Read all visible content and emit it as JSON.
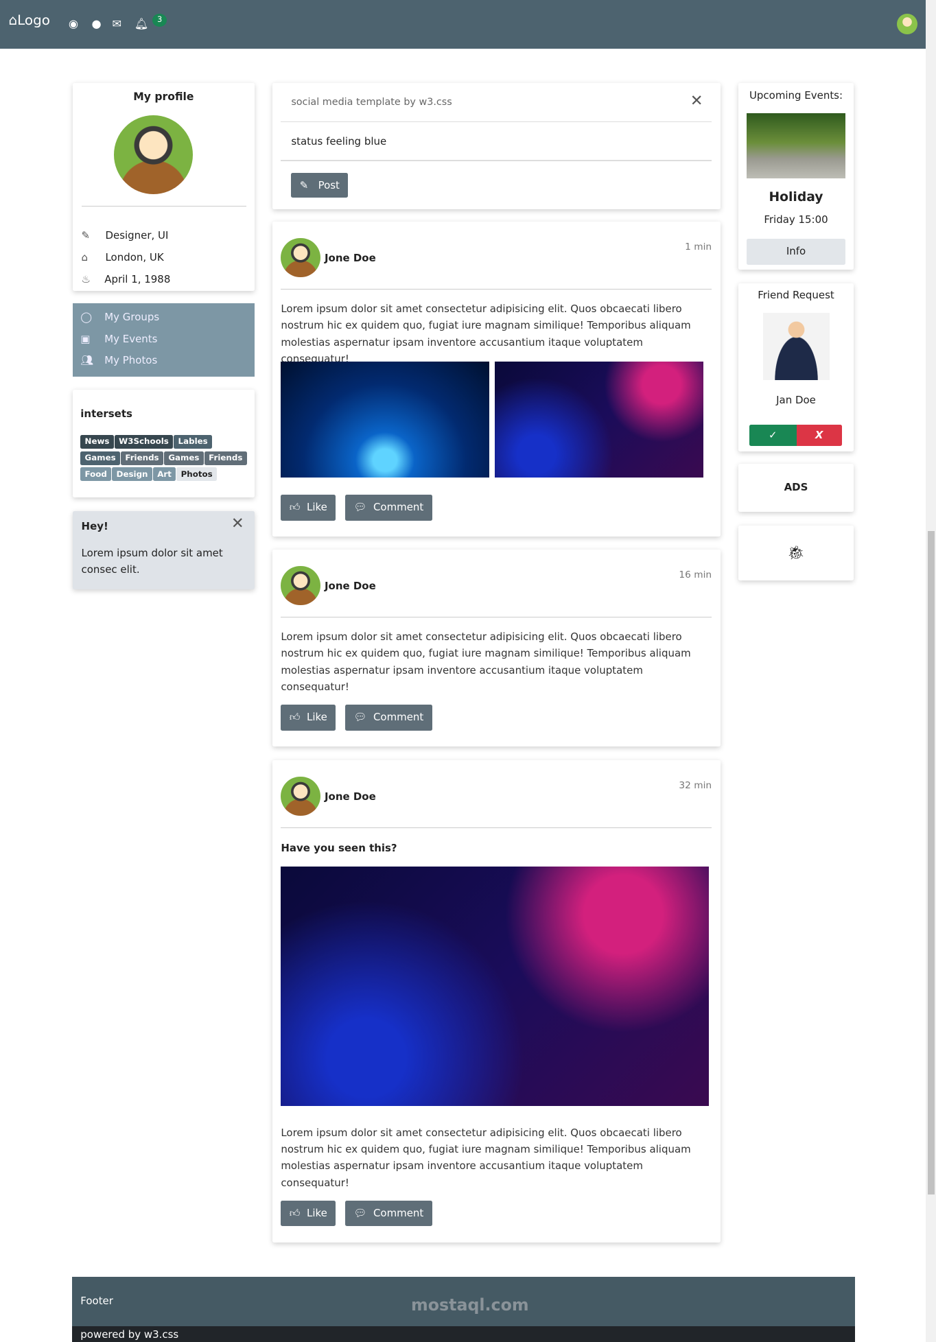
{
  "nav": {
    "logo": "Logo",
    "icons": [
      "home-icon",
      "globe-icon",
      "user-icon",
      "envelope-icon",
      "bell-icon"
    ],
    "notifications": "3",
    "color": "#4d636f"
  },
  "profile": {
    "title": "My profile",
    "job": "Designer, UI",
    "location": "London, UK",
    "birthday": "April 1, 1988"
  },
  "menu": {
    "items": [
      "My Groups",
      "My Events",
      "My Photos"
    ]
  },
  "interests": {
    "title": "intersets",
    "tags": [
      {
        "label": "News",
        "color": "#37474f"
      },
      {
        "label": "W3Schools",
        "color": "#37474f"
      },
      {
        "label": "Lables",
        "color": "#4d636f"
      },
      {
        "label": "Games",
        "color": "#4d636f"
      },
      {
        "label": "Friends",
        "color": "#616e78"
      },
      {
        "label": "Games",
        "color": "#616e78"
      },
      {
        "label": "Friends",
        "color": "#616e78"
      },
      {
        "label": "Food",
        "color": "#7d97a5"
      },
      {
        "label": "Design",
        "color": "#7d97a5"
      },
      {
        "label": "Art",
        "color": "#7d97a5"
      },
      {
        "label": "Photos",
        "color": "#e2e6ea"
      }
    ]
  },
  "alert": {
    "title": "Hey!",
    "text": "Lorem ipsum dolor sit amet consec elit."
  },
  "composer": {
    "title": "social media template by w3.css",
    "status": "status feeling blue",
    "post_label": "Post"
  },
  "posts": [
    {
      "author": "Jone Doe",
      "time": "1 min",
      "text": "Lorem ipsum dolor sit amet consectetur adipisicing elit. Quos obcaecati libero nostrum hic ex quidem quo, fugiat iure magnam similique! Temporibus aliquam molestias aspernatur ipsam inventore accusantium itaque voluptatem consequatur!",
      "like": "Like",
      "comment": "Comment"
    },
    {
      "author": "Jone Doe",
      "time": "16 min",
      "text": "Lorem ipsum dolor sit amet consectetur adipisicing elit. Quos obcaecati libero nostrum hic ex quidem quo, fugiat iure magnam similique! Temporibus aliquam molestias aspernatur ipsam inventore accusantium itaque voluptatem consequatur!",
      "like": "Like",
      "comment": "Comment"
    },
    {
      "author": "Jone Doe",
      "time": "32 min",
      "heading": "Have you seen this?",
      "text": "Lorem ipsum dolor sit amet consectetur adipisicing elit. Quos obcaecati libero nostrum hic ex quidem quo, fugiat iure magnam similique! Temporibus aliquam molestias aspernatur ipsam inventore accusantium itaque voluptatem consequatur!",
      "like": "Like",
      "comment": "Comment"
    }
  ],
  "events": {
    "title": "Upcoming Events:",
    "name": "Holiday",
    "time": "Friday 15:00",
    "info_label": "Info"
  },
  "friend": {
    "title": "Friend Request",
    "name": "Jan Doe",
    "accept": "✓",
    "decline": "X"
  },
  "ads": {
    "label": "ADS"
  },
  "footer": {
    "label": "Footer",
    "powered": "powered by ",
    "link": "w3.css",
    "watermark": "mostaql.com"
  }
}
